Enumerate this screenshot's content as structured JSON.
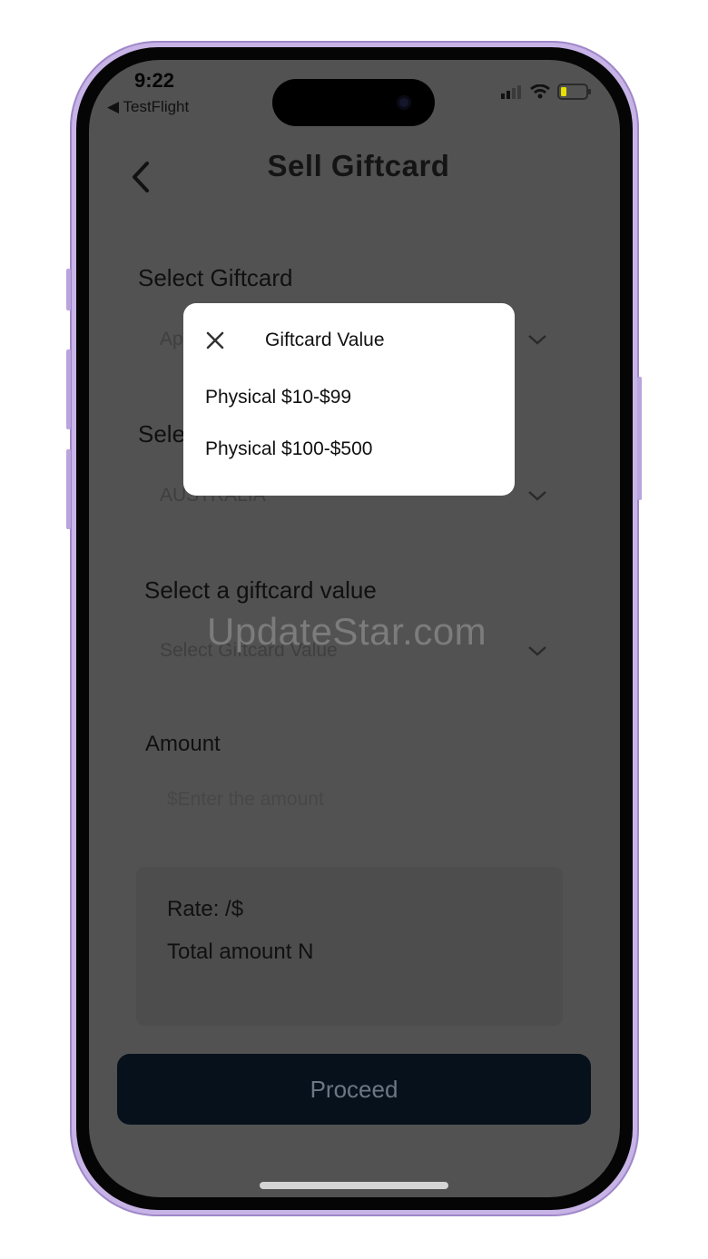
{
  "status_bar": {
    "time": "9:22",
    "back_app": "◀ TestFlight"
  },
  "header": {
    "title": "Sell Giftcard"
  },
  "form": {
    "giftcard_label": "Select Giftcard",
    "giftcard_value_partial": "Ap",
    "country_label_partial": "Sele",
    "country_value": "AUSTRALIA",
    "value_label": "Select a giftcard value",
    "value_placeholder": "Select Giftcard Value",
    "amount_label": "Amount",
    "amount_placeholder": "$Enter the amount",
    "rate_text": "Rate:  /$",
    "total_text": "Total amount  N"
  },
  "proceed_label": "Proceed",
  "watermark": "UpdateStar.com",
  "popup": {
    "title": "Giftcard Value",
    "options": [
      "Physical $10-$99",
      "Physical $100-$500"
    ]
  }
}
